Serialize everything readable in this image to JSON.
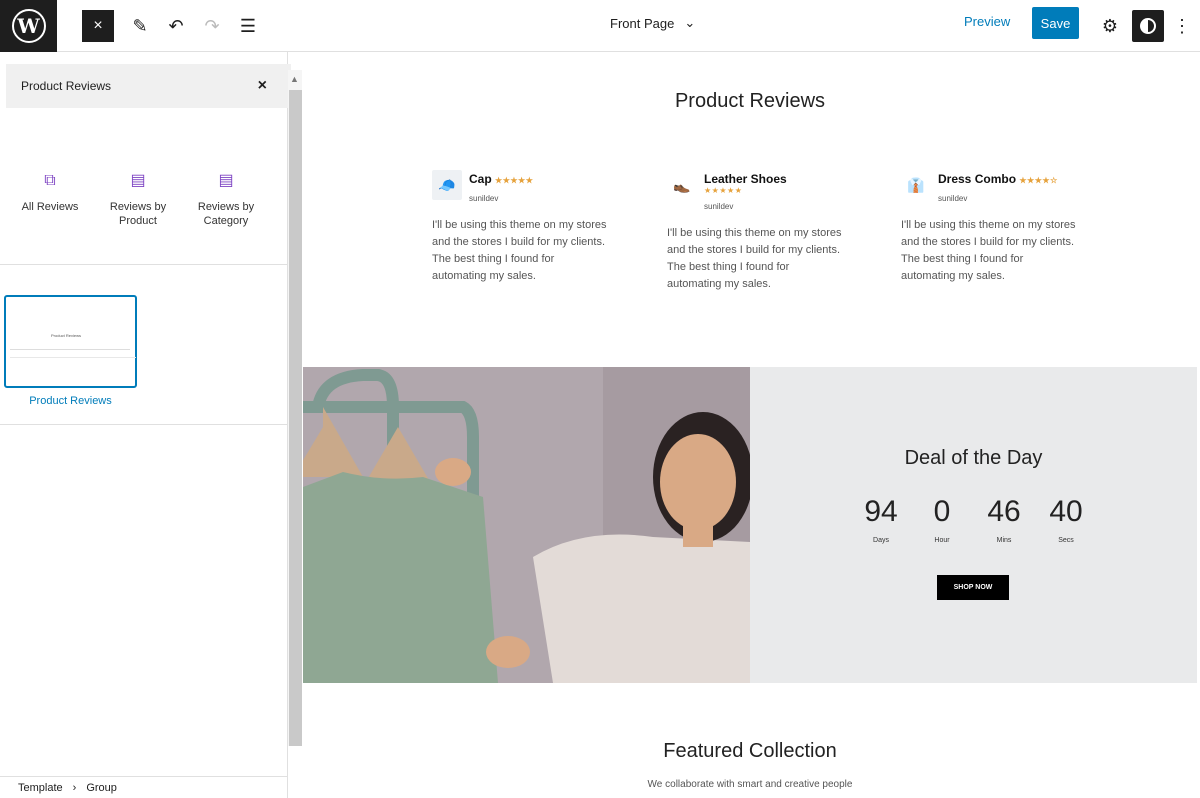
{
  "toolbar": {
    "logo_icon": "wordpress-logo-icon",
    "close_icon": "×",
    "edit_icon": "✎",
    "undo_icon": "↶",
    "redo_icon": "↷",
    "list_icon": "☰",
    "document_title": "Front Page",
    "chevron": "⌄",
    "preview_label": "Preview",
    "save_label": "Save",
    "gear_icon": "⚙",
    "more_icon": "⋮"
  },
  "sidebar": {
    "search_value": "Product Reviews",
    "clear_icon": "×",
    "block_types": [
      {
        "label": "All Reviews",
        "icon": "⧉"
      },
      {
        "label": "Reviews by Product",
        "icon": "▤"
      },
      {
        "label": "Reviews by Category",
        "icon": "▤"
      }
    ],
    "pattern_thumb_title": "Product Reviews",
    "pattern_label": "Product Reviews",
    "breadcrumb": [
      "Template",
      "Group"
    ],
    "breadcrumb_sep": "›"
  },
  "canvas": {
    "reviews_heading": "Product Reviews",
    "reviews": [
      {
        "name": "Cap",
        "stars": "★★★★★",
        "user": "sunildev",
        "text": "I'll be using this theme on my stores and the stores I build for my clients. The best thing I found for automating my sales.",
        "thumb_icon": "🧢"
      },
      {
        "name": "Leather Shoes",
        "stars": "★★★★★",
        "user": "sunildev",
        "text": "I'll be using this theme on my stores and the stores I build for my clients. The best thing I found for automating my sales.",
        "thumb_icon": "👞"
      },
      {
        "name": "Dress Combo",
        "stars": "★★★★☆",
        "user": "sunildev",
        "text": "I'll be using this theme on my stores and the stores I build for my clients. The best thing I found for automating my sales.",
        "thumb_icon": "👔"
      }
    ],
    "deal": {
      "title": "Deal of the Day",
      "countdown": [
        {
          "value": "94",
          "label": "Days"
        },
        {
          "value": "0",
          "label": "Hour"
        },
        {
          "value": "46",
          "label": "Mins"
        },
        {
          "value": "40",
          "label": "Secs"
        }
      ],
      "button_label": "SHOP NOW"
    },
    "featured_title": "Featured Collection",
    "featured_subtitle": "We collaborate with smart and creative people"
  }
}
